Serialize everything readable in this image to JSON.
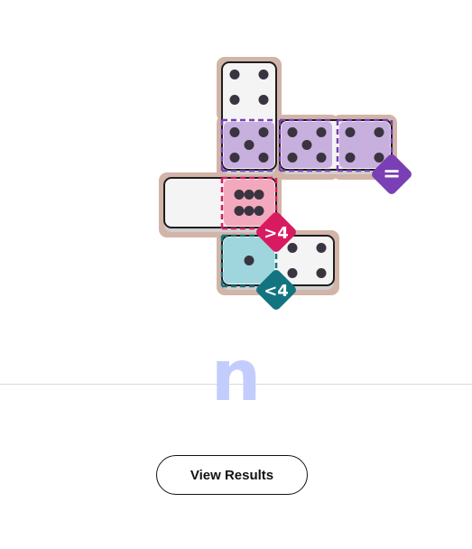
{
  "puzzle": {
    "board_color": "#d2b4a8",
    "tile_colors": {
      "face": "#f4f4f4",
      "edge": "#cfcfcf",
      "outline": "#1e1e1e",
      "pip": "#3a3340"
    },
    "regions": [
      {
        "id": "purple",
        "fill": "#c7b0dd",
        "stroke": "#7a3fb4",
        "rule": "="
      },
      {
        "id": "pink",
        "fill": "#f3a9bd",
        "stroke": "#d81b60",
        "rule": ">4"
      },
      {
        "id": "teal",
        "fill": "#9fd6dd",
        "stroke": "#117480",
        "rule": "<4"
      }
    ],
    "cells": [
      {
        "row": 0,
        "col": 2,
        "pips": 4,
        "region": null
      },
      {
        "row": 1,
        "col": 2,
        "pips": 5,
        "region": "purple"
      },
      {
        "row": 1,
        "col": 3,
        "pips": 5,
        "region": "purple"
      },
      {
        "row": 1,
        "col": 4,
        "pips": 4,
        "region": "purple"
      },
      {
        "row": 2,
        "col": 1,
        "pips": 0,
        "region": null
      },
      {
        "row": 2,
        "col": 2,
        "pips": 6,
        "region": "pink"
      },
      {
        "row": 3,
        "col": 2,
        "pips": 1,
        "region": "teal"
      },
      {
        "row": 3,
        "col": 3,
        "pips": 4,
        "region": null
      }
    ],
    "dominoes": [
      {
        "a": [
          0,
          2
        ],
        "b": [
          1,
          2
        ]
      },
      {
        "a": [
          1,
          3
        ],
        "b": [
          1,
          4
        ]
      },
      {
        "a": [
          2,
          1
        ],
        "b": [
          2,
          2
        ]
      },
      {
        "a": [
          3,
          2
        ],
        "b": [
          3,
          3
        ]
      }
    ],
    "badges": [
      {
        "region": "purple",
        "label": "=",
        "color": "#7a3fb4",
        "anchor": [
          1,
          4
        ]
      },
      {
        "region": "pink",
        "label": ">4",
        "color": "#d81b60",
        "anchor": [
          2,
          2
        ]
      },
      {
        "region": "teal",
        "label": "<4",
        "color": "#117480",
        "anchor": [
          3,
          2
        ]
      }
    ]
  },
  "logo": {
    "letter": "n",
    "color": "#c3cdfd"
  },
  "actions": {
    "view_results_label": "View Results"
  }
}
